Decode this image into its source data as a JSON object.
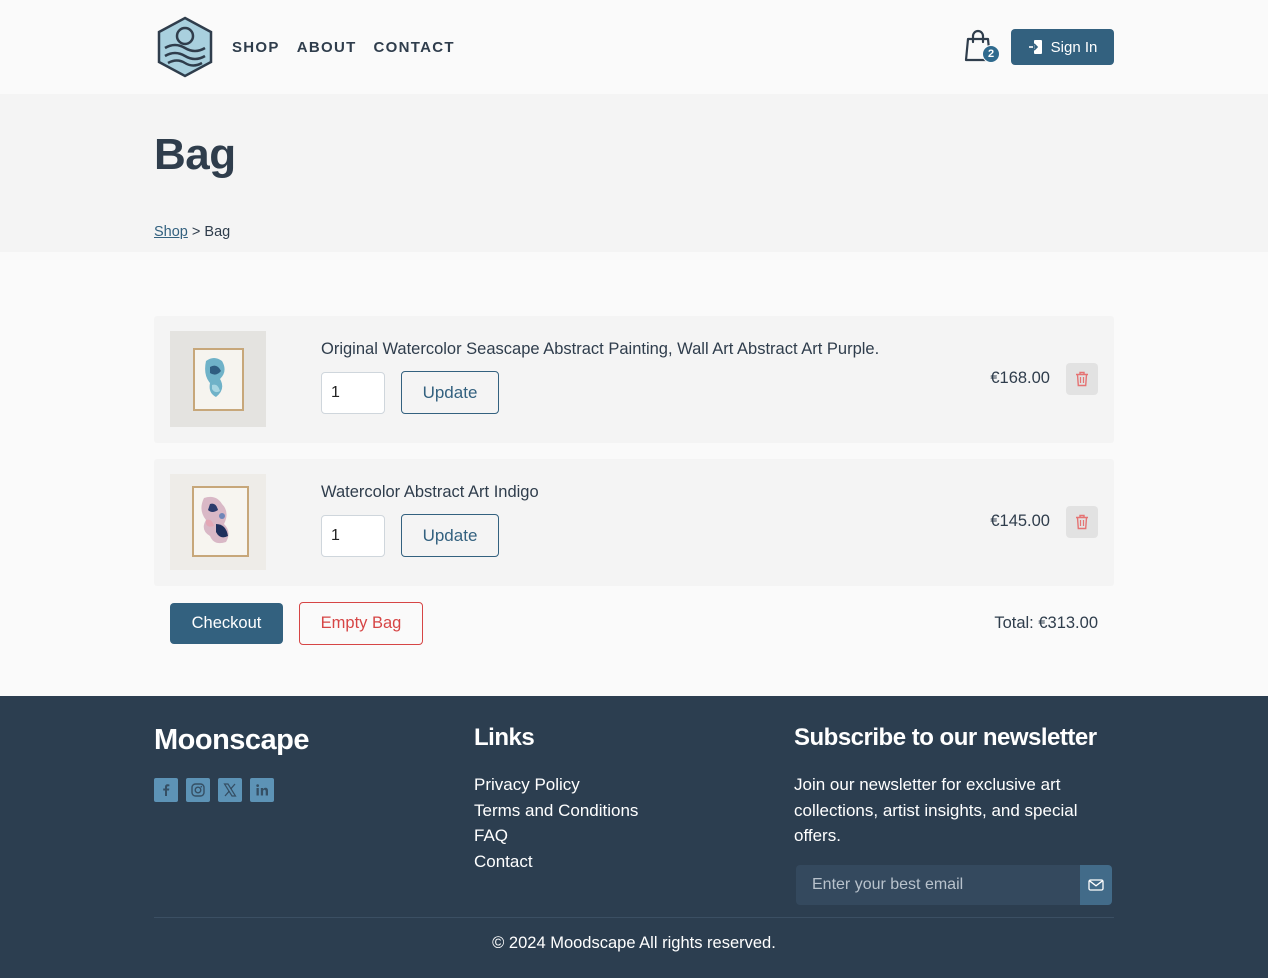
{
  "header": {
    "nav": [
      "SHOP",
      "ABOUT",
      "CONTACT"
    ],
    "bag_count": "2",
    "signin_label": "Sign In"
  },
  "page": {
    "title": "Bag",
    "breadcrumb_link": "Shop",
    "breadcrumb_separator": " > ",
    "breadcrumb_current": "Bag"
  },
  "cart": {
    "items": [
      {
        "name": "Original Watercolor Seascape Abstract Painting, Wall Art Abstract Art Purple.",
        "quantity": "1",
        "update_label": "Update",
        "price": "€168.00"
      },
      {
        "name": "Watercolor Abstract Art Indigo",
        "quantity": "1",
        "update_label": "Update",
        "price": "€145.00"
      }
    ],
    "checkout_label": "Checkout",
    "empty_label": "Empty Bag",
    "total": "Total: €313.00"
  },
  "footer": {
    "brand": "Moonscape",
    "socials": [
      "facebook-icon",
      "instagram-icon",
      "x-twitter-icon",
      "linkedin-icon"
    ],
    "links_title": "Links",
    "links": [
      "Privacy Policy",
      "Terms and Conditions",
      "FAQ",
      "Contact"
    ],
    "newsletter_title": "Subscribe to our newsletter",
    "newsletter_text": "Join our newsletter for exclusive art collections, artist insights, and special offers.",
    "email_placeholder": "Enter your best email",
    "copyright": "© 2024 Moodscape All rights reserved."
  },
  "colors": {
    "primary": "#33617f",
    "danger": "#d64545",
    "footer_bg": "#2c3e50",
    "text": "#2f3d4c"
  }
}
